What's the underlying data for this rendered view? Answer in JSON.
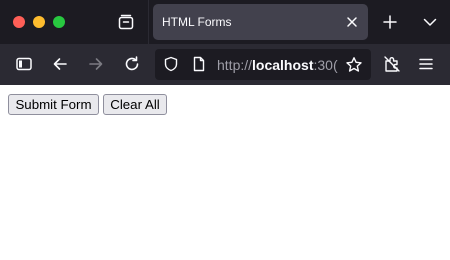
{
  "browser": {
    "tab": {
      "title": "HTML Forms"
    },
    "url": {
      "protocol": "http://",
      "host": "localhost",
      "port_fragment": ":30("
    }
  },
  "page": {
    "buttons": {
      "submit_label": "Submit Form",
      "clear_label": "Clear All"
    }
  },
  "colors": {
    "tab_strip": "#1c1b22",
    "toolbar": "#2b2a33",
    "active_tab": "#42414d",
    "close_dot": "#ff5f57",
    "minimize_dot": "#febc2e",
    "maximize_dot": "#28c840"
  },
  "icons": [
    "window-close-dot",
    "window-minimize-dot",
    "window-maximize-dot",
    "tab-overview-icon",
    "tab-close-icon",
    "new-tab-icon",
    "tab-list-chevron-icon",
    "sidebar-toggle-icon",
    "back-arrow-icon",
    "forward-arrow-icon",
    "reload-icon",
    "shield-icon",
    "page-icon",
    "bookmark-star-icon",
    "extensions-icon",
    "menu-icon"
  ]
}
